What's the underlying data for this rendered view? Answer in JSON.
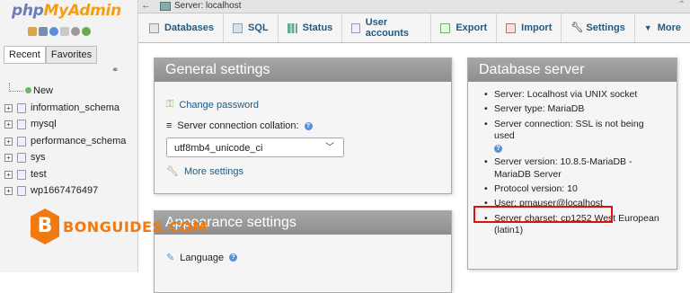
{
  "logo": {
    "part1": "php",
    "part2": "MyAdmin"
  },
  "nav": {
    "tabs": [
      "Recent",
      "Favorites"
    ],
    "new_label": "New",
    "databases": [
      "information_schema",
      "mysql",
      "performance_schema",
      "sys",
      "test",
      "wp1667476497"
    ]
  },
  "topbar": {
    "server": "Server: localhost"
  },
  "menu": {
    "tabs": [
      "Databases",
      "SQL",
      "Status",
      "User accounts",
      "Export",
      "Import",
      "Settings",
      "More"
    ]
  },
  "general": {
    "title": "General settings",
    "change_password": "Change password",
    "collation_label": "Server connection collation:",
    "collation_value": "utf8mb4_unicode_ci",
    "more_settings": "More settings"
  },
  "appearance": {
    "title": "Appearance settings",
    "language_label": "Language"
  },
  "dbserver": {
    "title": "Database server",
    "items": [
      "Server: Localhost via UNIX socket",
      "Server type: MariaDB",
      "Server connection: SSL is not being used",
      "Server version: 10.8.5-MariaDB - MariaDB Server",
      "Protocol version: 10",
      "User: pmauser@localhost",
      "Server charset: cp1252 West European (latin1)"
    ]
  },
  "watermark": {
    "letter": "B",
    "text": "BONGUIDES.COM"
  },
  "colors": {
    "link": "#235a81",
    "accent": "#f89c0e",
    "highlight": "#e01010",
    "watermark": "#f07a10"
  }
}
